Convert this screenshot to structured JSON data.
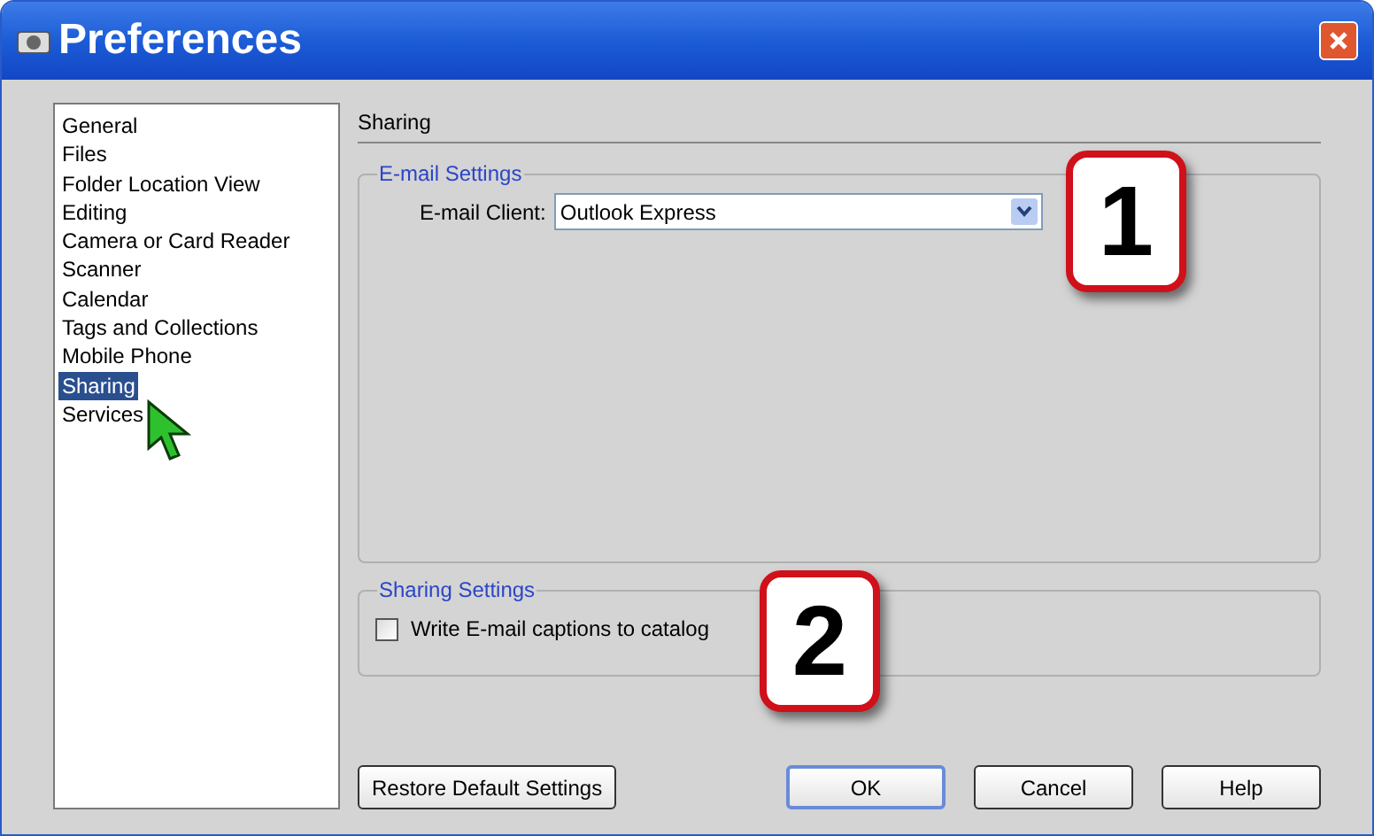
{
  "window": {
    "title": "Preferences"
  },
  "sidebar": {
    "items": [
      {
        "label": "General",
        "selected": false
      },
      {
        "label": "Files",
        "selected": false
      },
      {
        "label": "Folder Location View",
        "selected": false
      },
      {
        "label": "Editing",
        "selected": false
      },
      {
        "label": "Camera or Card Reader",
        "selected": false
      },
      {
        "label": "Scanner",
        "selected": false
      },
      {
        "label": "Calendar",
        "selected": false
      },
      {
        "label": "Tags and Collections",
        "selected": false
      },
      {
        "label": "Mobile Phone",
        "selected": false
      },
      {
        "label": "Sharing",
        "selected": true
      },
      {
        "label": "Services",
        "selected": false
      }
    ]
  },
  "panel": {
    "title": "Sharing",
    "email_settings": {
      "legend": "E-mail Settings",
      "client_label": "E-mail Client:",
      "client_value": "Outlook Express"
    },
    "sharing_settings": {
      "legend": "Sharing Settings",
      "checkbox": {
        "label": "Write E-mail captions to catalog",
        "checked": false
      }
    }
  },
  "callouts": [
    "1",
    "2"
  ],
  "buttons": [
    {
      "label": "Restore Default Settings",
      "default": false
    },
    {
      "label": "OK",
      "default": true
    },
    {
      "label": "Cancel",
      "default": false
    },
    {
      "label": "Help",
      "default": false
    }
  ]
}
